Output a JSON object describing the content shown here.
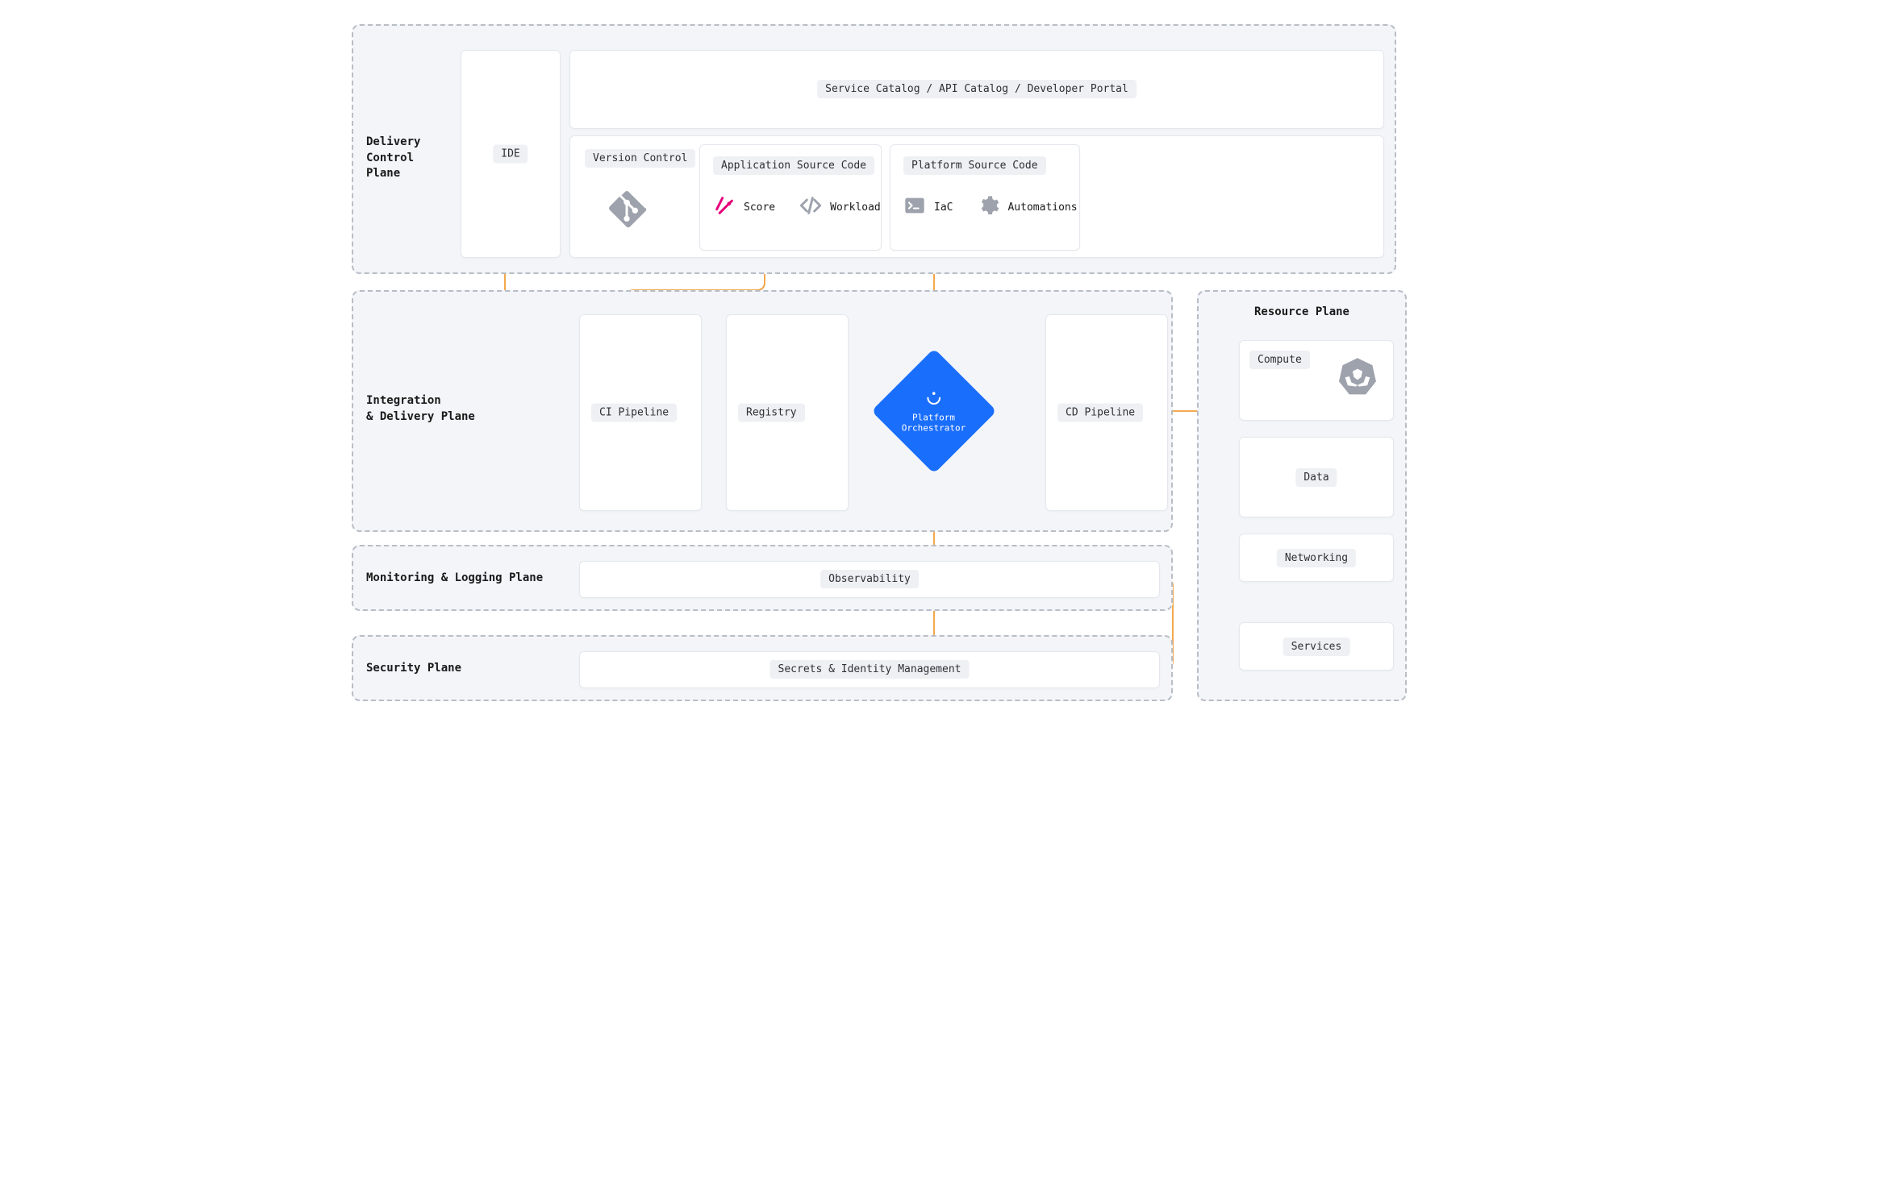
{
  "planes": {
    "delivery_control": "Delivery\nControl\nPlane",
    "integration_delivery": "Integration\n& Delivery Plane",
    "monitoring_logging": "Monitoring & Logging Plane",
    "security": "Security Plane",
    "resource": "Resource Plane"
  },
  "delivery": {
    "ide": "IDE",
    "catalog": "Service Catalog / API Catalog / Developer Portal",
    "version_control": "Version Control",
    "app_source": "Application Source Code",
    "platform_source": "Platform Source Code",
    "score": "Score",
    "workload": "Workload",
    "iac": "IaC",
    "automations": "Automations"
  },
  "integration": {
    "ci": "CI Pipeline",
    "registry": "Registry",
    "orchestrator": "Platform\nOrchestrator",
    "cd": "CD Pipeline"
  },
  "monitoring": {
    "observability": "Observability"
  },
  "security": {
    "secrets": "Secrets & Identity Management"
  },
  "resource": {
    "compute": "Compute",
    "data": "Data",
    "networking": "Networking",
    "services": "Services"
  },
  "colors": {
    "connector": "#f29e3a",
    "accent": "#1a6efc",
    "score": "#e6007a"
  }
}
